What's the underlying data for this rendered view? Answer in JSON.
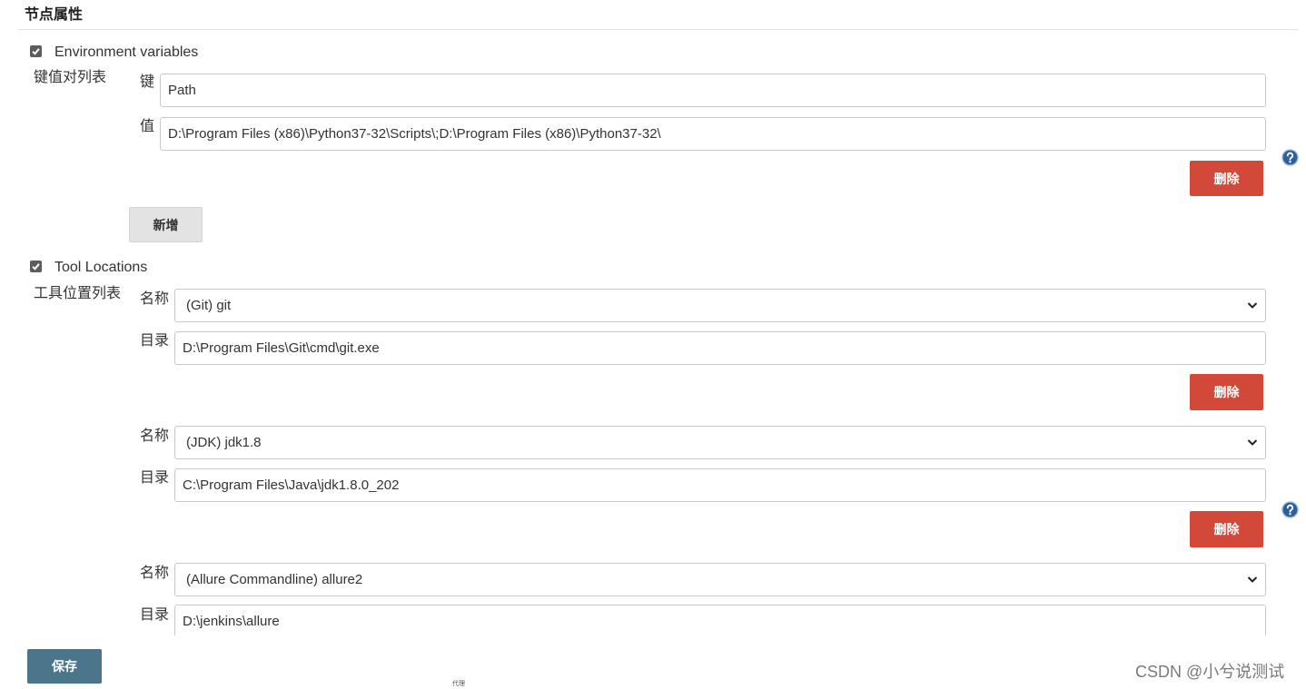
{
  "section": {
    "title": "节点属性"
  },
  "env": {
    "checked": true,
    "checkbox_label": "Environment variables",
    "list_label": "键值对列表",
    "key_label": "键",
    "value_label": "值",
    "vars": [
      {
        "key": "Path",
        "value": "D:\\Program Files (x86)\\Python37-32\\Scripts\\;D:\\Program Files (x86)\\Python37-32\\"
      }
    ],
    "delete_label": "删除",
    "add_label": "新增"
  },
  "tools": {
    "checked": true,
    "checkbox_label": "Tool Locations",
    "list_label": "工具位置列表",
    "name_label": "名称",
    "home_label": "目录",
    "delete_label": "删除",
    "items": [
      {
        "name": "(Git) git",
        "home": "D:\\Program Files\\Git\\cmd\\git.exe"
      },
      {
        "name": "(JDK) jdk1.8",
        "home": "C:\\Program Files\\Java\\jdk1.8.0_202"
      },
      {
        "name": "(Allure Commandline) allure2",
        "home": "D:\\jenkins\\allure"
      }
    ]
  },
  "footer": {
    "save_label": "保存",
    "proxy_label": "代理"
  },
  "watermark": "CSDN @小兮说测试",
  "icons": {
    "help": "help-icon",
    "check": "checkmark-icon",
    "select": "chevron-down-icon"
  },
  "colors": {
    "danger": "#d24939",
    "primary": "#4b758b",
    "help": "#2d5f9f",
    "checkbox": "#5c5c5c",
    "neutral": "#e3e3e3"
  }
}
